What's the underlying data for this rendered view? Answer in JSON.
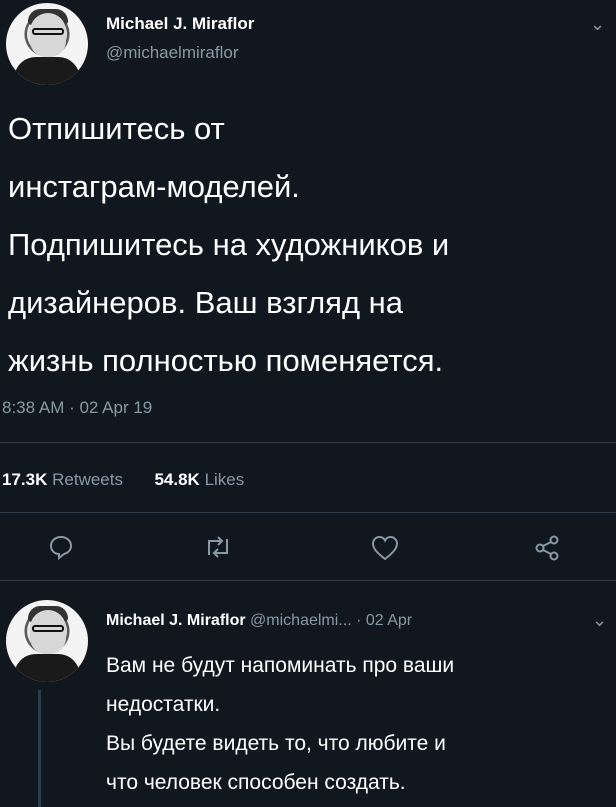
{
  "tweet": {
    "name": "Michael J. Miraflor",
    "handle": "@michaelmiraflor",
    "lines": [
      "Отпишитесь от",
      "инстаграм-моделей.",
      "Подпишитесь на художников и",
      "дизайнеров. Ваш взгляд на",
      "жизнь полностью поменяется."
    ],
    "timestamp": "8:38 AM · 02 Apr 19",
    "retweets_count": "17.3K",
    "retweets_label": "Retweets",
    "likes_count": "54.8K",
    "likes_label": "Likes"
  },
  "actions": {
    "icons": [
      "reply-icon",
      "retweet-icon",
      "like-icon",
      "share-icon"
    ]
  },
  "reply": {
    "name": "Michael J. Miraflor",
    "handle": "@michaelmi...",
    "date": "· 02 Apr",
    "lines": [
      "Вам не будут напоминать про ваши",
      "недостатки.",
      "Вы будете видеть то, что любите и",
      "что человек способен создать."
    ]
  },
  "colors": {
    "background": "#10171e",
    "secondary_text": "#8899a6",
    "divider": "#2f3b46"
  }
}
